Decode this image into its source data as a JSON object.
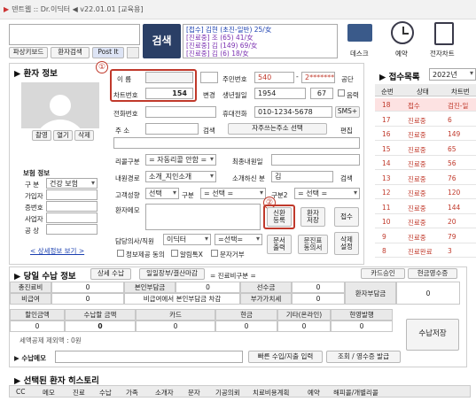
{
  "titlebar": {
    "title": "덴트웹 :: Dr.이딕터 ◀ v22.01.01 [교육용]"
  },
  "toolbar": {
    "btn1": "파상키보드",
    "btn2": "환자검색",
    "btn3": "Post It",
    "search": "검색",
    "dropdown_lines": [
      "[접수] 김현 (초진-일반) 25/女",
      "[진료중] 조 (65) 41/女",
      "[진료중] 김 (149) 69/女",
      "[진료중] 김 (6) 18/女"
    ],
    "icon1": "데스크",
    "icon2": "예약",
    "icon3": "전자차트"
  },
  "patient": {
    "title": "▶ 환자 정보",
    "name_label": "이  름",
    "chart_label": "차트번호",
    "chart_no": "154",
    "change": "변경",
    "jumin_label": "주민번호",
    "jumin1": "540",
    "jumin2": "2*******",
    "gongdan": "공단",
    "birth_label": "생년월일",
    "birth": "1954",
    "age": "67",
    "lunar": "음력",
    "phone_label": "전화번호",
    "mobile_label": "휴대전화",
    "mobile": "010-1234-5678",
    "sms": "SMS+",
    "addr_label": "주  소",
    "search": "검색",
    "addr_btn": "자주쓰는주소 선택",
    "edit": "편집",
    "photo_btns": [
      "촬영",
      "열기",
      "삭제"
    ],
    "ins_title": "보험 정보",
    "ins_kind_label": "구  분",
    "ins_kind": "건강 보험",
    "ins_fields": [
      "가입자",
      "증번호",
      "사업자",
      "공  상"
    ],
    "detail_link": "< 상세정보 보기 >",
    "care_label": "리콜구분",
    "care_val": "= 자동리콜 안함 =",
    "last_label": "최종내원일",
    "route_label": "내원경로",
    "route_val": "소개_지인소개",
    "introducer_label": "소개하신 분",
    "introducer": "김",
    "tendency_label": "고객성향",
    "sel": "선택",
    "gubun": "구분",
    "sel_eq": "= 선택 =",
    "gubun2": "구분2",
    "memo_label": "환자메모",
    "doctor_label": "담당의사/직원",
    "doctor": "이딕터",
    "staff": "=선택=",
    "checks": [
      "정보제공 동의",
      "알림톡X",
      "문자거부"
    ],
    "right_btns": [
      "신환\n등록",
      "환자\n저장",
      "접수",
      "문서\n출력",
      "문진표\n동의서",
      "삭제\n설정"
    ]
  },
  "receipt": {
    "title": "▶ 접수목록",
    "year": "2022년",
    "headers": [
      "순번",
      "상태",
      "차트번"
    ],
    "rows": [
      {
        "no": "18",
        "status": "접수",
        "chart": "검진-일",
        "hl": true
      },
      {
        "no": "17",
        "status": "진료중",
        "chart": "6"
      },
      {
        "no": "16",
        "status": "진료중",
        "chart": "149"
      },
      {
        "no": "15",
        "status": "진료중",
        "chart": "65"
      },
      {
        "no": "14",
        "status": "진료중",
        "chart": "56"
      },
      {
        "no": "13",
        "status": "진료중",
        "chart": "76"
      },
      {
        "no": "12",
        "status": "진료중",
        "chart": "120"
      },
      {
        "no": "11",
        "status": "진료중",
        "chart": "144"
      },
      {
        "no": "10",
        "status": "진료중",
        "chart": "20"
      },
      {
        "no": "9",
        "status": "진료중",
        "chart": "79"
      },
      {
        "no": "8",
        "status": "진료완료",
        "chart": "3"
      }
    ]
  },
  "payment": {
    "title": "▶ 당일 수납 정보",
    "tab1": "상세 수납",
    "tab2": "일일장부/결산마감",
    "type": "= 진료비구분 =",
    "card_approve": "카드승인",
    "cash_receipt": "현금영수증",
    "r1": [
      "총진료비",
      "0",
      "본인부담금",
      "0",
      "선수금",
      "0",
      "환자부담금",
      "0"
    ],
    "r2": [
      "비급여",
      "0",
      "비급여에서 본인부담금 차감",
      "부가가치세",
      "0"
    ],
    "heads": [
      "할인금액",
      "수납할 금액",
      "카드",
      "현금",
      "기타(온라인)",
      "현영발행"
    ],
    "vals": [
      "0",
      "0",
      "0",
      "0",
      "0",
      "0"
    ],
    "tax_note": "세액공제 제외액 : 0원",
    "save": "수납저장",
    "memo_label": "▶ 수납메모",
    "quick": "빠른 수입/지출 입력",
    "inquiry": "조회 / 영수증 발급"
  },
  "history": {
    "title": "▶ 선택된 환자 히스토리",
    "cols": [
      "CC",
      "메모",
      "진료",
      "수납",
      "가족",
      "소개자",
      "문자",
      "기공의뢰",
      "치료비용계획",
      "예약",
      "해피콜/개별리콜"
    ]
  },
  "annot": {
    "one": "①",
    "two": "②"
  },
  "colors": {
    "accent": "#2a3f66",
    "red": "#c0392b",
    "highlight": "#d32f2f"
  }
}
